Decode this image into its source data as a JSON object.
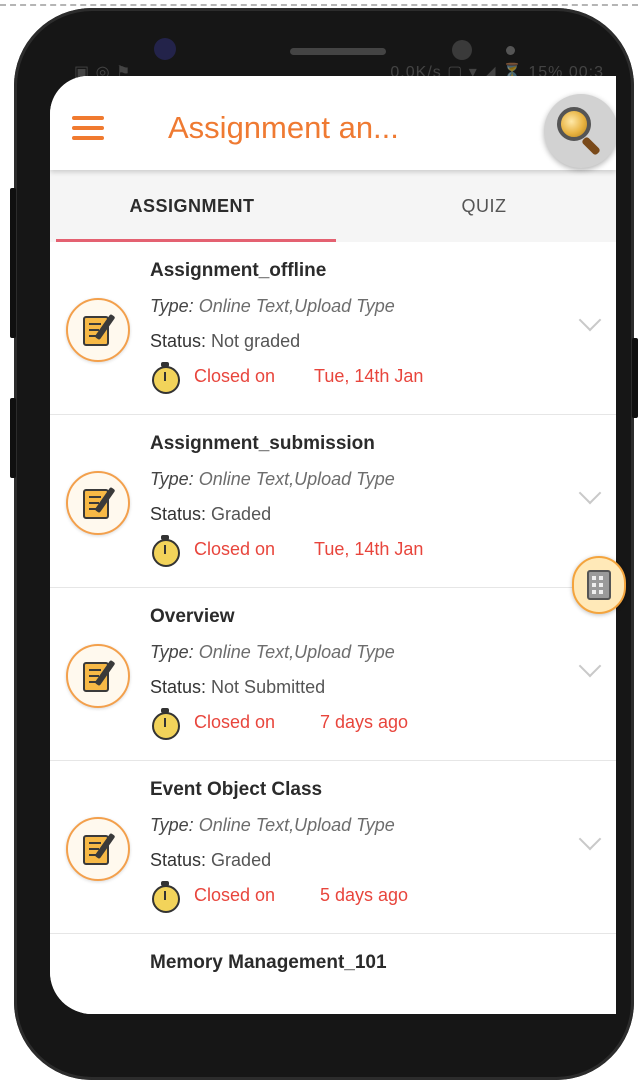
{
  "status_bar": {
    "left": "▣ ◎ ⚑",
    "speed": "0.0K/s",
    "battery": "15%",
    "time": "00:3"
  },
  "app": {
    "title": "Assignment an..."
  },
  "tabs": [
    {
      "label": "ASSIGNMENT",
      "active": true
    },
    {
      "label": "QUIZ",
      "active": false
    }
  ],
  "colors": {
    "accent": "#ef7a32",
    "closed": "#e8453c",
    "tab_indicator": "#e46171"
  },
  "items": [
    {
      "title": "Assignment_offline",
      "type_label": "Type:",
      "type_value": "Online Text,Upload Type",
      "status_label": "Status:",
      "status_value": "Not graded",
      "closed_label": "Closed on",
      "closed_date": "Tue, 14th  Jan"
    },
    {
      "title": "Assignment_submission",
      "type_label": "Type:",
      "type_value": "Online Text,Upload Type",
      "status_label": "Status:",
      "status_value": "Graded",
      "closed_label": "Closed on",
      "closed_date": "Tue, 14th  Jan"
    },
    {
      "title": "Overview",
      "type_label": "Type:",
      "type_value": "Online Text,Upload Type",
      "status_label": "Status:",
      "status_value": "Not Submitted",
      "closed_label": "Closed on",
      "closed_date": "7 days ago"
    },
    {
      "title": "Event Object Class",
      "type_label": "Type:",
      "type_value": "Online Text,Upload Type",
      "status_label": "Status:",
      "status_value": "Graded",
      "closed_label": "Closed on",
      "closed_date": "5 days ago"
    },
    {
      "title": "Memory Management_101"
    }
  ],
  "icons": {
    "menu": "hamburger-menu-icon",
    "search": "search-icon",
    "assignment": "assignment-icon",
    "timer": "stopwatch-icon",
    "expand": "chevron-down-icon",
    "calculator": "calculator-icon"
  }
}
